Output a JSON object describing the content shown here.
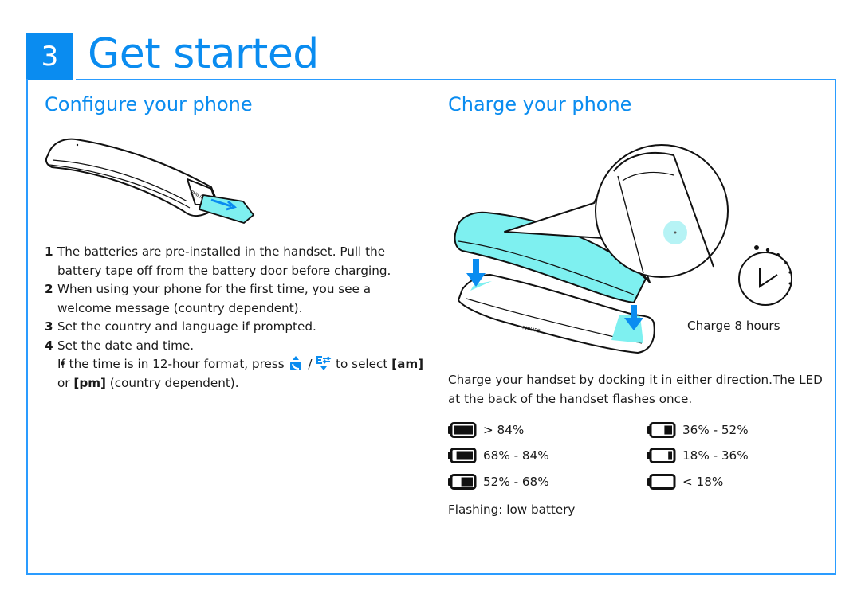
{
  "chapter": {
    "number": "3",
    "title": "Get started"
  },
  "configure": {
    "title": "Configure your phone",
    "steps": [
      {
        "num": "1",
        "text": "The batteries are pre-installed in the handset. Pull the battery tape off from the battery door before charging."
      },
      {
        "num": "2",
        "text": "When using your phone for the first time, you see a welcome message (country dependent)."
      },
      {
        "num": "3",
        "text": "Set the country and language if prompted."
      },
      {
        "num": "4",
        "text": "Set the date and time."
      }
    ],
    "sub_bullet": {
      "bullet": "•",
      "before": "If the time is in 12-hour format, press",
      "separator": "/",
      "after": "to select",
      "am": "[am]",
      "or": "or",
      "pm": "[pm]",
      "tail": "(country dependent).",
      "icons": [
        "up-call-key-icon",
        "down-redial-key-icon"
      ]
    }
  },
  "charge": {
    "title": "Charge your phone",
    "hours_label": "Charge 8 hours",
    "description": "Charge your handset by docking it in either direction.The LED at the back of the handset flashes once.",
    "battery_levels": [
      {
        "label": "> 84%",
        "level": 1.0
      },
      {
        "label": "68% - 84%",
        "level": 0.85
      },
      {
        "label": "52% - 68%",
        "level": 0.6
      },
      {
        "label": "36% - 52%",
        "level": 0.4
      },
      {
        "label": "18% - 36%",
        "level": 0.2
      },
      {
        "label": "< 18%",
        "level": 0.0
      }
    ],
    "flashing_note": "Flashing: low battery"
  },
  "colors": {
    "accent": "#0a8cf0",
    "frame": "#2a9cff",
    "highlight": "#7ef0f0"
  }
}
